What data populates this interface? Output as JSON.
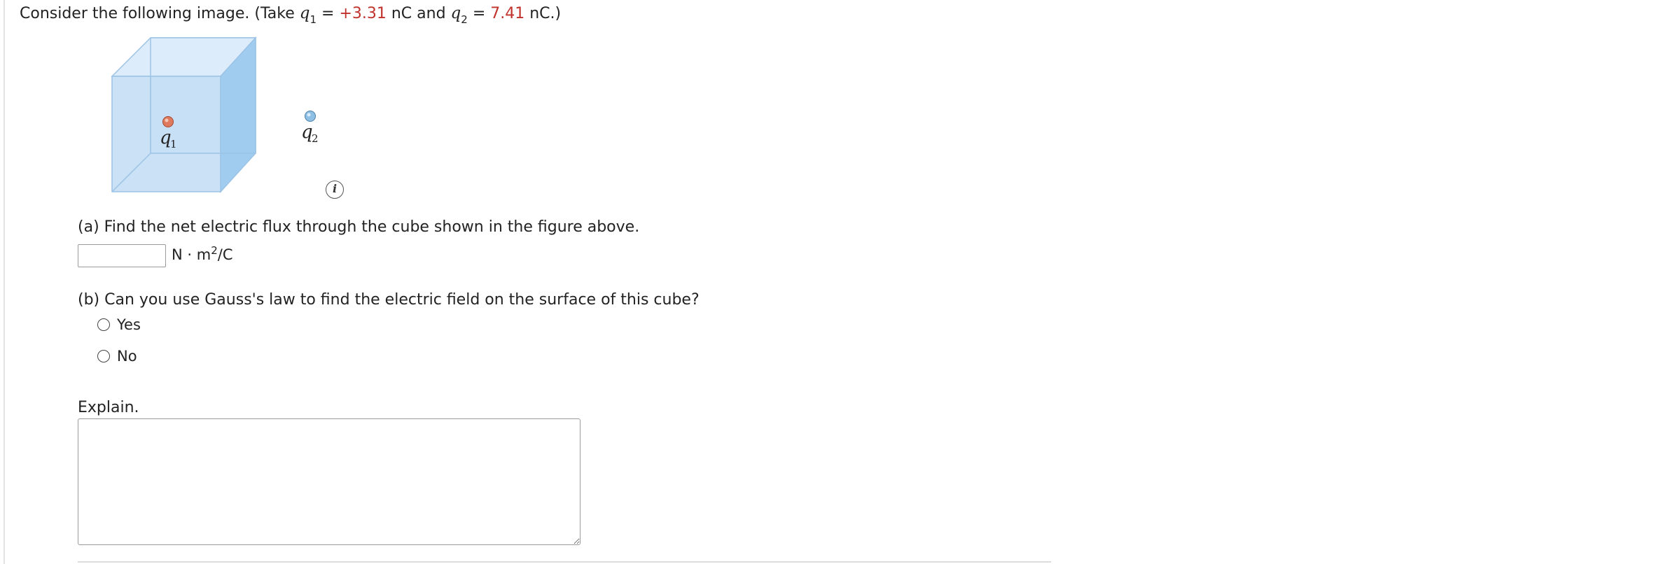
{
  "question": {
    "intro": "Consider the following image. (Take ",
    "q1_symbol": "q",
    "q1_sub": "1",
    "eq1": " = ",
    "q1_value": "+3.31",
    "q1_unit": " nC and ",
    "q2_symbol": "q",
    "q2_sub": "2",
    "eq2": " = ",
    "q2_value": "7.41",
    "q2_unit": " nC.)"
  },
  "figure": {
    "label_q1": "q",
    "label_q1_sub": "1",
    "label_q2": "q",
    "label_q2_sub": "2",
    "info_icon": "info-icon",
    "info_glyph": "i",
    "colors": {
      "cube_fill": "#cfe4f7",
      "cube_edge": "#9cc3e6",
      "q1_charge": "#e07a5f",
      "q2_charge": "#8ec0e6"
    }
  },
  "part_a": {
    "prompt": "(a) Find the net electric flux through the cube shown in the figure above.",
    "input_value": "",
    "unit_prefix": "N · m",
    "unit_exp": "2",
    "unit_suffix": "/C"
  },
  "part_b": {
    "prompt": "(b) Can you use Gauss's law to find the electric field on the surface of this cube?",
    "options": [
      "Yes",
      "No"
    ]
  },
  "explain": {
    "label": "Explain.",
    "value": ""
  }
}
